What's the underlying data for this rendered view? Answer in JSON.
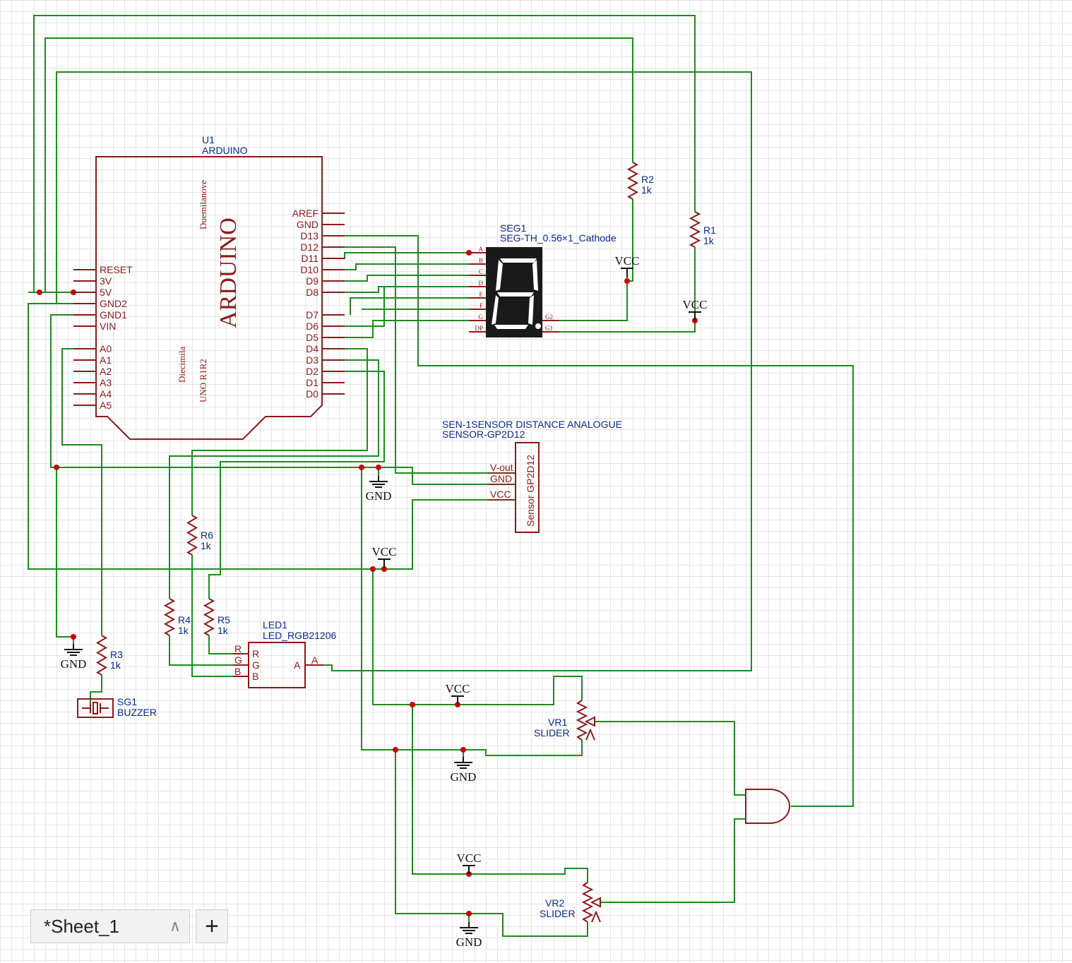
{
  "arduino": {
    "ref": "U1",
    "name": "ARDUINO",
    "logo": "ARDUINO",
    "board1": "Duemilanove",
    "board2": "Diecimila",
    "board3": "UNO R1R2",
    "left_pins": [
      "RESET",
      "3V",
      "5V",
      "GND2",
      "GND1",
      "VIN",
      "A0",
      "A1",
      "A2",
      "A3",
      "A4",
      "A5"
    ],
    "right_pins": [
      "AREF",
      "GND",
      "D13",
      "D12",
      "D11",
      "D10",
      "D9",
      "D8",
      "D7",
      "D6",
      "D5",
      "D4",
      "D3",
      "D2",
      "D1",
      "D0"
    ]
  },
  "seg": {
    "ref": "SEG1",
    "name": "SEG-TH_0.56×1_Cathode",
    "pins_left": [
      "A",
      "B",
      "C",
      "D",
      "E",
      "F",
      "G",
      "DP"
    ],
    "pins_right": [
      "G2",
      "G1"
    ]
  },
  "r1": {
    "ref": "R1",
    "val": "1k"
  },
  "r2": {
    "ref": "R2",
    "val": "1k"
  },
  "r3": {
    "ref": "R3",
    "val": "1k"
  },
  "r4": {
    "ref": "R4",
    "val": "1k"
  },
  "r5": {
    "ref": "R5",
    "val": "1k"
  },
  "r6": {
    "ref": "R6",
    "val": "1k"
  },
  "sensor": {
    "title1": "SEN-1SENSOR DISTANCE ANALOGUE",
    "title2": "SENSOR-GP2D12",
    "body": "Sensor GP2D12",
    "pins": [
      "V-out",
      "GND",
      "VCC"
    ]
  },
  "led": {
    "ref": "LED1",
    "name": "LED_RGB21206",
    "pins_in": [
      "R",
      "G",
      "B"
    ],
    "inner": [
      "R",
      "G",
      "B"
    ],
    "pin_a": "A",
    "inner_a": "A"
  },
  "buzzer": {
    "ref": "SG1",
    "name": "BUZZER"
  },
  "vr1": {
    "ref": "VR1",
    "name": "SLIDER"
  },
  "vr2": {
    "ref": "VR2",
    "name": "SLIDER"
  },
  "power": {
    "vcc": "VCC",
    "gnd": "GND"
  },
  "colors": {
    "wire": "#1f8a1f",
    "part": "#8b1a1a",
    "label": "#0a2a8a",
    "junction": "#cc0000"
  },
  "sheet": {
    "tab_label": "*Sheet_1",
    "add_label": "+"
  }
}
